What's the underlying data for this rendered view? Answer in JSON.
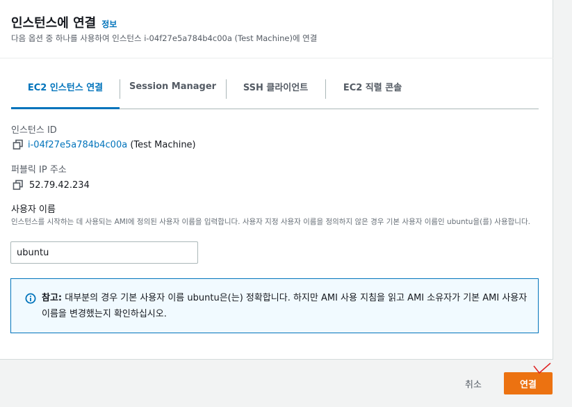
{
  "header": {
    "title": "인스턴스에 연결",
    "info_link": "정보",
    "subtitle": "다음 옵션 중 하나를 사용하여 인스턴스 i-04f27e5a784b4c00a (Test Machine)에 연결"
  },
  "tabs": [
    {
      "label": "EC2 인스턴스 연결",
      "active": true
    },
    {
      "label": "Session Manager",
      "active": false
    },
    {
      "label": "SSH 클라이언트",
      "active": false
    },
    {
      "label": "EC2 직렬 콘솔",
      "active": false
    }
  ],
  "instance": {
    "label": "인스턴스 ID",
    "id": "i-04f27e5a784b4c00a",
    "name": " (Test Machine)"
  },
  "public_ip": {
    "label": "퍼블릭 IP 주소",
    "value": "52.79.42.234"
  },
  "username": {
    "label": "사용자 이름",
    "description": "인스턴스를 시작하는 데 사용되는 AMI에 정의된 사용자 이름을 입력합니다. 사용자 지정 사용자 이름을 정의하지 않은 경우 기본 사용자 이름인 ubuntu을(를) 사용합니다.",
    "value": "ubuntu"
  },
  "alert": {
    "icon": "info-icon",
    "strong": "참고:",
    "text": " 대부분의 경우 기본 사용자 이름 ubuntu은(는) 정확합니다. 하지만 AMI 사용 지침을 읽고 AMI 소유자가 기본 AMI 사용자 이름을 변경했는지 확인하십시오."
  },
  "footer": {
    "cancel_label": "취소",
    "connect_label": "연결"
  },
  "colors": {
    "accent": "#0073bb",
    "primary_button": "#ec7211",
    "annotation": "#e02020"
  }
}
